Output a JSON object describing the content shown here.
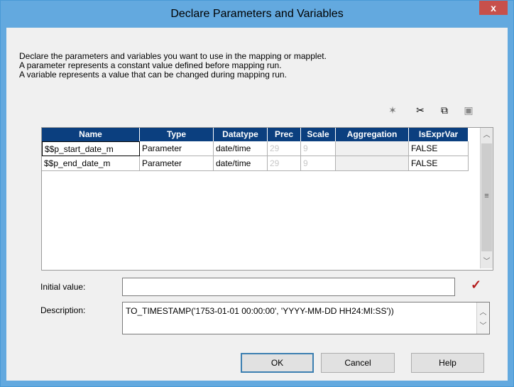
{
  "window": {
    "title": "Declare Parameters and Variables",
    "close_label": "x"
  },
  "intro": {
    "line1": "Declare the parameters and variables you want to use in the mapping or mapplet.",
    "line2": "A parameter represents a constant value defined before mapping run.",
    "line3": "A variable represents a value that can be changed during mapping run."
  },
  "toolbar": [
    {
      "name": "new-icon",
      "glyph": "✶"
    },
    {
      "name": "cut-icon",
      "glyph": "✂"
    },
    {
      "name": "copy-icon",
      "glyph": "⧉"
    },
    {
      "name": "paste-icon",
      "glyph": "📋"
    }
  ],
  "grid": {
    "columns": [
      "Name",
      "Type",
      "Datatype",
      "Prec",
      "Scale",
      "Aggregation",
      "IsExprVar"
    ],
    "rows": [
      {
        "name": "$$p_start_date_m",
        "type": "Parameter",
        "datatype": "date/time",
        "prec": "29",
        "scale": "9",
        "aggregation": "",
        "isexprvar": "FALSE"
      },
      {
        "name": "$$p_end_date_m",
        "type": "Parameter",
        "datatype": "date/time",
        "prec": "29",
        "scale": "9",
        "aggregation": "",
        "isexprvar": "FALSE"
      }
    ]
  },
  "initial_value": {
    "label": "Initial value:",
    "value": ""
  },
  "description": {
    "label": "Description:",
    "value": "TO_TIMESTAMP('1753-01-01 00:00:00', 'YYYY-MM-DD HH24:MI:SS'))"
  },
  "buttons": {
    "ok": "OK",
    "cancel": "Cancel",
    "help": "Help"
  },
  "colors": {
    "header_bg": "#0b3f7f",
    "titlebar": "#63a9df",
    "close_bg": "#c7504b",
    "check": "#b31b1b"
  }
}
